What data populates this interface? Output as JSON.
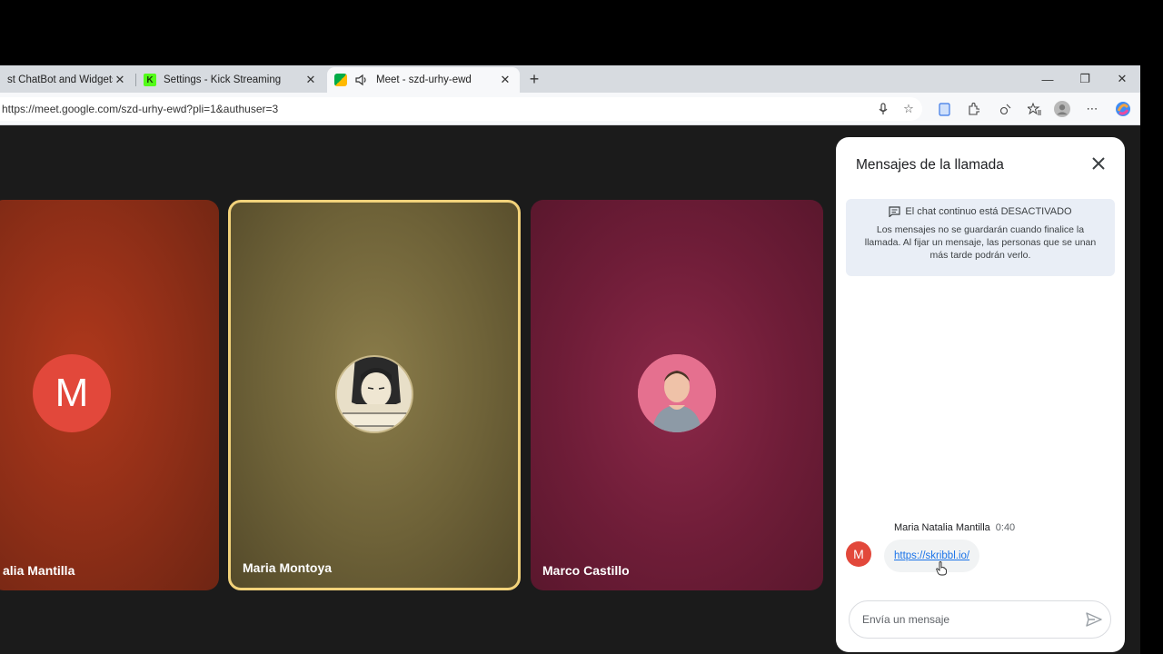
{
  "browser": {
    "tabs": [
      {
        "title": "st ChatBot and Widgets fo"
      },
      {
        "title": "Settings - Kick Streaming"
      },
      {
        "title": "Meet - szd-urhy-ewd"
      }
    ],
    "url": "https://meet.google.com/szd-urhy-ewd?pli=1&authuser=3"
  },
  "participants": [
    {
      "name": "alia Mantilla",
      "initial": "M"
    },
    {
      "name": "Maria Montoya"
    },
    {
      "name": "Marco Castillo"
    }
  ],
  "chat": {
    "title": "Mensajes de la llamada",
    "notice_title": "El chat continuo está DESACTIVADO",
    "notice_body": "Los mensajes no se guardarán cuando finalice la llamada. Al fijar un mensaje, las personas que se unan más tarde podrán verlo.",
    "messages": [
      {
        "sender": "Maria Natalia Mantilla",
        "time": "0:40",
        "initial": "M",
        "text": "https://skribbl.io/"
      }
    ],
    "input_placeholder": "Envía un mensaje"
  },
  "colors": {
    "accent_blue": "#1a73e8",
    "avatar_red": "#e2483b",
    "speaking_border": "#f2d27a"
  },
  "icons": [
    "kick-icon",
    "meet-icon",
    "speaker-icon",
    "mic-icon",
    "star-icon",
    "extensions-icon",
    "favorites-icon",
    "profile-icon",
    "more-icon",
    "copilot-icon",
    "chat-icon",
    "close-icon",
    "send-icon"
  ]
}
